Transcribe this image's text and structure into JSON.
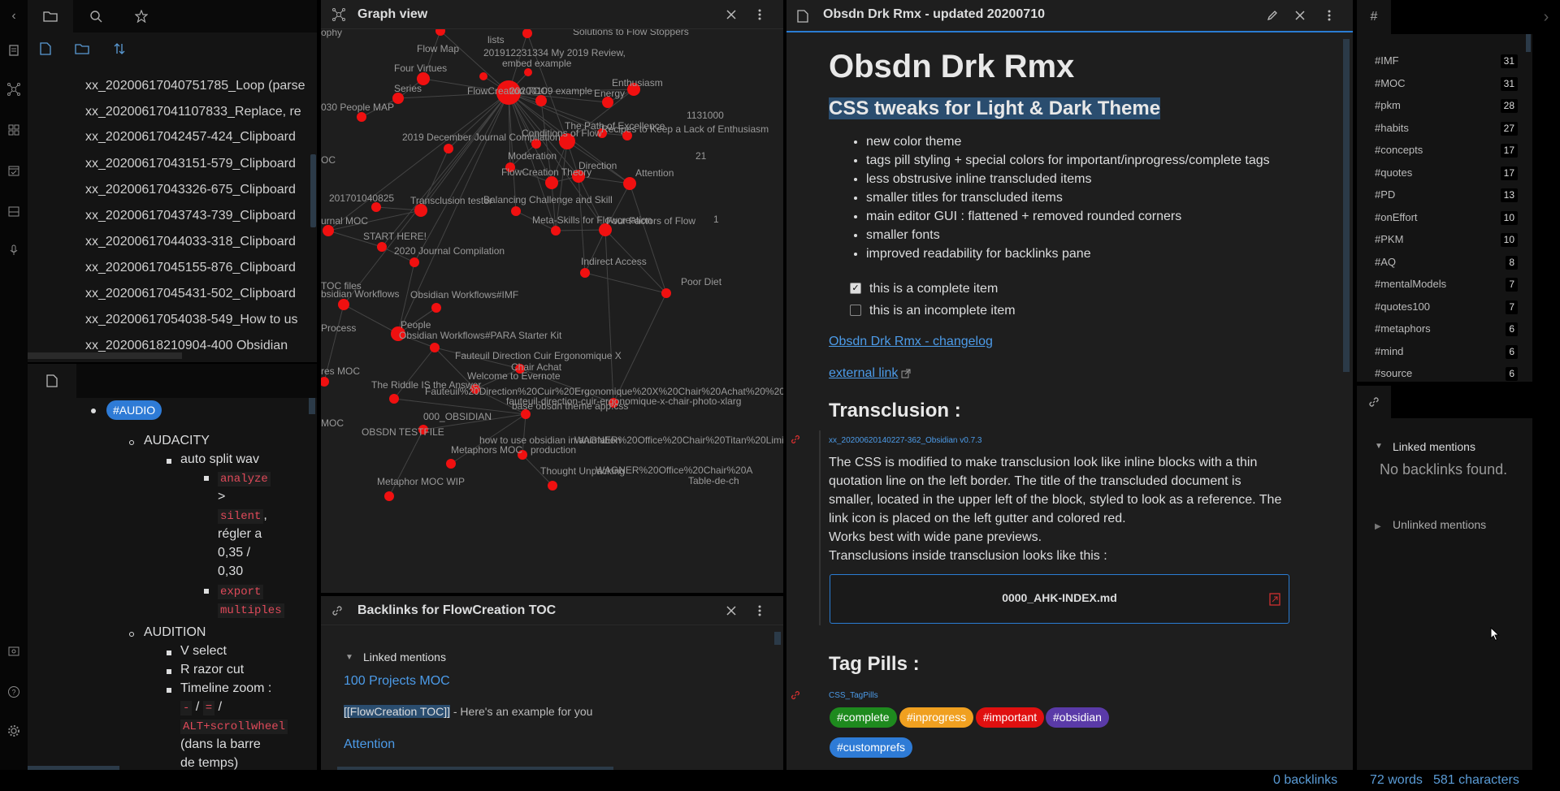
{
  "file_explorer": {
    "files": [
      "xx_20200617040751785_Loop (parse",
      "xx_20200617041107833_Replace, re",
      "xx_20200617042457-424_Clipboard",
      "xx_20200617043151-579_Clipboard",
      "xx_20200617043326-675_Clipboard",
      "xx_20200617043743-739_Clipboard",
      "xx_20200617044033-318_Clipboard",
      "xx_20200617045155-876_Clipboard",
      "xx_20200617045431-502_Clipboard",
      "xx_20200617054038-549_How to us",
      "xx_20200618210904-400 Obsidian"
    ]
  },
  "outline": {
    "audio_tag": "#AUDIO",
    "audacity": "AUDACITY",
    "auto_split": "auto split wav",
    "analyze": "analyze",
    "gt": ">",
    "silent": "silent",
    "comma": ",",
    "regler1": "régler a",
    "regler2": "0,35 /",
    "regler3": "0,30",
    "export": "export",
    "multiples": "multiples",
    "audition": "AUDITION",
    "vselect": "V select",
    "razor": "R razor cut",
    "timeline": "Timeline zoom :",
    "minus": "-",
    "slash1": "/",
    "equals": "=",
    "slash2": "/",
    "alt": "ALT+scrollwheel",
    "dans1": "(dans la barre",
    "dans2": "de temps)"
  },
  "graph_view": {
    "title": "Graph view",
    "labels": [
      {
        "t": "Flow Map"
      },
      {
        "t": "Four Virtues"
      },
      {
        "t": "Series"
      },
      {
        "t": "FlowCreation TOC"
      },
      {
        "t": "20200109 example"
      },
      {
        "t": "Enthusiasm"
      },
      {
        "t": "Energy"
      },
      {
        "t": "030 People MAP"
      },
      {
        "t": "201912231334 My 2019 Review,"
      },
      {
        "t": "embed example"
      },
      {
        "t": "lists"
      },
      {
        "t": "Solutions to Flow Stoppers"
      },
      {
        "t": "The Path of Excellence"
      },
      {
        "t": "Recipes to Keep a Lack of Enthusiasm"
      },
      {
        "t": "1131000"
      },
      {
        "t": "2019 December Journal Compilation"
      },
      {
        "t": "Conditions of Flow"
      },
      {
        "t": "Moderation"
      },
      {
        "t": "FlowCreation Theory"
      },
      {
        "t": "Direction"
      },
      {
        "t": "Attention"
      },
      {
        "t": "201701040825"
      },
      {
        "t": "Transclusion tester"
      },
      {
        "t": "Balancing Challenge and Skill"
      },
      {
        "t": "Meta-Skills for Flowcreation"
      },
      {
        "t": "Four Factors of Flow"
      },
      {
        "t": "urnal MOC"
      },
      {
        "t": "START HERE!"
      },
      {
        "t": "2020 Journal Compilation"
      },
      {
        "t": "Indirect Access"
      },
      {
        "t": "Poor Diet"
      },
      {
        "t": "TOC files"
      },
      {
        "t": "bsidian Workflows"
      },
      {
        "t": "Obsidian Workflows#IMF"
      },
      {
        "t": "People"
      },
      {
        "t": "Process"
      },
      {
        "t": "Obsidian Workflows#PARA Starter Kit"
      },
      {
        "t": "Fauteuil Direction Cuir Ergonomique X"
      },
      {
        "t": "Chair Achat"
      },
      {
        "t": "res MOC"
      },
      {
        "t": "Welcome to Evernote"
      },
      {
        "t": "The Riddle IS the Answer"
      },
      {
        "t": "Fauteuil%20Direction%20Cuir%20Ergonomique%20X%20Chair%20Achat%20%20"
      },
      {
        "t": "fauteuil-direction-cuir-ergonomique-x-chair-photo-xlarg"
      },
      {
        "t": "base obsdn theme app.css"
      },
      {
        "t": "000_OBSIDIAN"
      },
      {
        "t": "MOC"
      },
      {
        "t": "OBSDN TESTFILE"
      },
      {
        "t": "how to use obsidian in animation"
      },
      {
        "t": "production"
      },
      {
        "t": "WAGNER%20Office%20Chair%20Titan%20Limite"
      },
      {
        "t": "Metaphors MOC"
      },
      {
        "t": "Thought Unpacking"
      },
      {
        "t": "WAGNER%20Office%20Chair%20A"
      },
      {
        "t": "Table-de-ch"
      },
      {
        "t": "Metaphor MOC WIP"
      },
      {
        "t": "ophy"
      },
      {
        "t": "OC"
      },
      {
        "t": "21"
      },
      {
        "t": "1"
      }
    ]
  },
  "backlinks_pane": {
    "title": "Backlinks for FlowCreation TOC",
    "linked_mentions": "Linked mentions",
    "item1": "100 Projects MOC",
    "item1_link": "[[FlowCreation TOC]]",
    "item1_rest": " - Here's an example for you",
    "item2": "Attention"
  },
  "editor": {
    "title": "Obsdn Drk Rmx - updated 20200710",
    "h1": "Obsdn Drk Rmx",
    "h2": "CSS tweaks for Light & Dark Theme",
    "bullets": [
      "new color theme",
      "tags pill styling + special colors for important/inprogress/complete tags",
      "less obstrusive inline transcluded items",
      "smaller titles for transcluded items",
      "main editor GUI : flattened + removed rounded corners",
      "smaller fonts",
      "improved readability for backlinks pane"
    ],
    "task_complete": "this is a complete item",
    "task_incomplete": "this is an incomplete item",
    "changelog_link": "Obsdn Drk Rmx - changelog",
    "external_link": "external link",
    "transclusion_heading": "Transclusion :",
    "transclusion_source": "xx_20200620140227-362_Obsidian v0.7.3",
    "transclusion_text": [
      "The CSS is modified to make transclusion look like inline blocks with a thin",
      "quotation line on the left border. The title of the transcluded document is",
      "smaller, located in the upper left of the block, styled to look as a reference. The",
      "link icon is placed on the left gutter and colored red.",
      "Works best with wide pane previews.",
      "Transclusions inside transclusion looks like this :"
    ],
    "nested_embed": "0000_AHK-INDEX.md",
    "tagpills_heading": "Tag Pills :",
    "tagpills_source": "CSS_TagPills",
    "tags": [
      {
        "label": "#complete",
        "color": "#1e8a1e"
      },
      {
        "label": "#inprogress",
        "color": "#f0a020"
      },
      {
        "label": "#important",
        "color": "#e01010"
      },
      {
        "label": "#obsidian",
        "color": "#5a3aa8"
      },
      {
        "label": "#customprefs",
        "color": "#2e7bd6"
      }
    ]
  },
  "tag_pane": {
    "tags": [
      {
        "name": "#IMF",
        "count": "31"
      },
      {
        "name": "#MOC",
        "count": "31"
      },
      {
        "name": "#pkm",
        "count": "28"
      },
      {
        "name": "#habits",
        "count": "27"
      },
      {
        "name": "#concepts",
        "count": "17"
      },
      {
        "name": "#quotes",
        "count": "17"
      },
      {
        "name": "#PD",
        "count": "13"
      },
      {
        "name": "#onEffort",
        "count": "10"
      },
      {
        "name": "#PKM",
        "count": "10"
      },
      {
        "name": "#AQ",
        "count": "8"
      },
      {
        "name": "#mentalModels",
        "count": "7"
      },
      {
        "name": "#quotes100",
        "count": "7"
      },
      {
        "name": "#metaphors",
        "count": "6"
      },
      {
        "name": "#mind",
        "count": "6"
      },
      {
        "name": "#source",
        "count": "6"
      }
    ]
  },
  "right_backlinks": {
    "linked_mentions": "Linked mentions",
    "no_backlinks": "No backlinks found.",
    "unlinked_mentions": "Unlinked mentions"
  },
  "status_bar": {
    "backlinks": "0 backlinks",
    "words": "72 words",
    "characters": "581 characters"
  }
}
